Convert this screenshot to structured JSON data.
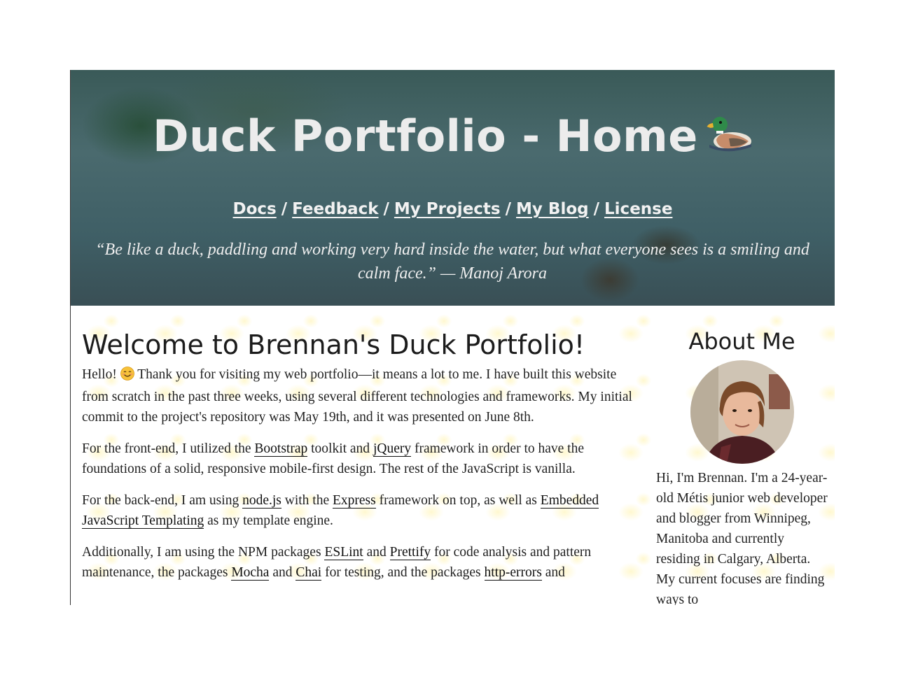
{
  "hero": {
    "title": "Duck Portfolio - Home",
    "title_icon": "duck-icon",
    "nav": [
      {
        "label": "Docs"
      },
      {
        "label": "Feedback"
      },
      {
        "label": "My Projects"
      },
      {
        "label": "My Blog"
      },
      {
        "label": "License"
      }
    ],
    "nav_separator": "/",
    "quote": "“Be like a duck, paddling and working very hard inside the water, but what everyone sees is a smiling and calm face.” — Manoj Arora"
  },
  "main": {
    "heading": "Welcome to Brennan's Duck Portfolio!",
    "p1": {
      "before": "Hello!",
      "icon": "smiling-face-icon",
      "after": "Thank you for visiting my web portfolio—it means a lot to me. I have built this website from scratch in the past three weeks, using several different technologies and frameworks. My initial commit to the project's repository was May 19th, and it was presented on June 8th."
    },
    "p2": {
      "t1": "For the front-end, I utilized the",
      "link1": "Bootstrap",
      "t2": "toolkit and",
      "link2": "jQuery",
      "t3": "framework in order to have the foundations of a solid, responsive mobile-first design. The rest of the JavaScript is vanilla."
    },
    "p3": {
      "t1": "For the back-end, I am using",
      "link1": "node.js",
      "t2": "with the",
      "link2": "Express",
      "t3": "framework on top, as well as",
      "link3": "Embedded JavaScript Templating",
      "t4": "as my template engine."
    },
    "p4": {
      "t1": "Additionally, I am using the NPM packages",
      "link1": "ESLint",
      "t2": "and",
      "link2": "Prettify",
      "t3": "for code analysis and pattern maintenance, the packages",
      "link3": "Mocha",
      "t4": "and",
      "link4": "Chai",
      "t5": "for testing, and the packages",
      "link5": "http-errors",
      "t6": "and"
    }
  },
  "aside": {
    "heading": "About Me",
    "avatar": "profile-photo",
    "bio": "Hi, I'm Brennan. I'm a 24-year-old Métis junior web developer and blogger from Winnipeg, Manitoba and currently residing in Calgary, Alberta. My current focuses are finding ways to"
  },
  "colors": {
    "hero_text": "#ececec",
    "body_text": "#222222",
    "duck_pattern": "#fff2a0"
  }
}
